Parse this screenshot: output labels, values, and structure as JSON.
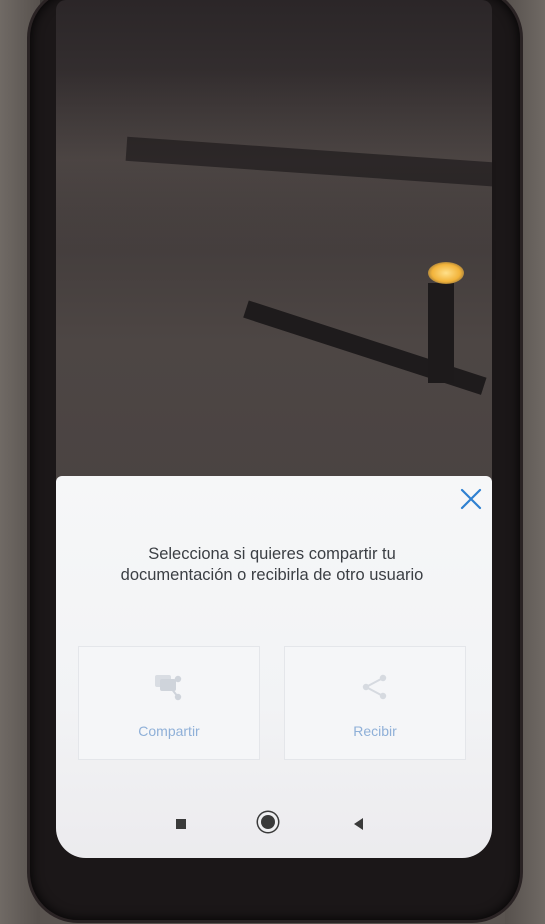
{
  "dialog": {
    "message": "Selecciona si quieres compartir tu documentación o recibirla de otro usuario",
    "close_icon": "close-icon"
  },
  "options": [
    {
      "label": "Compartir",
      "icon": "share-documents-icon"
    },
    {
      "label": "Recibir",
      "icon": "receive-share-icon"
    }
  ],
  "navigation": {
    "recent_icon": "recent-apps-icon",
    "home_icon": "home-icon",
    "back_icon": "back-icon"
  },
  "colors": {
    "accent": "#2f80d1",
    "option_label": "#8fb0d8",
    "message_text": "#3b3f44",
    "sheet_bg": "#f4f5f7"
  }
}
